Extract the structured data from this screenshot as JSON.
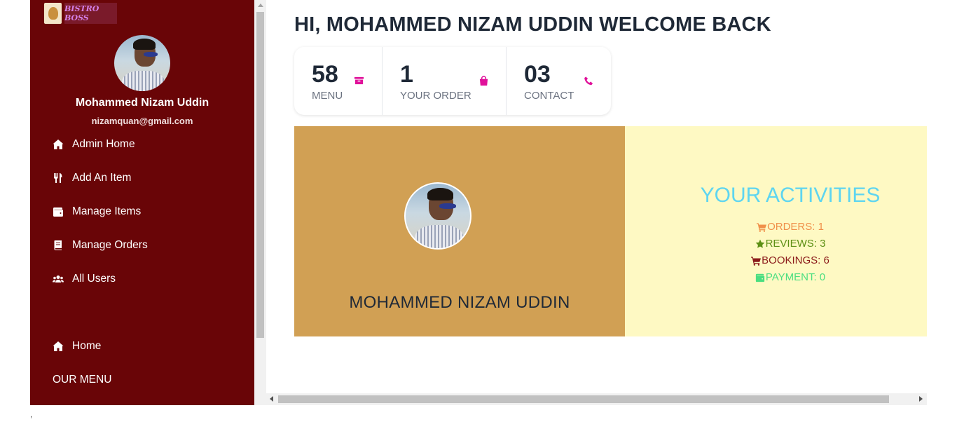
{
  "brand": {
    "logo_text": "BISTRO BOSS"
  },
  "user": {
    "name": "Mohammed Nizam Uddin",
    "email": "nizamquan@gmail.com",
    "name_upper": "MOHAMMED NIZAM UDDIN"
  },
  "nav": {
    "items": [
      {
        "label": "Admin Home",
        "icon": "home-icon"
      },
      {
        "label": "Add An Item",
        "icon": "utensils-icon"
      },
      {
        "label": "Manage Items",
        "icon": "wallet-icon"
      },
      {
        "label": "Manage Orders",
        "icon": "book-icon"
      },
      {
        "label": "All Users",
        "icon": "users-icon"
      }
    ],
    "footer_items": [
      {
        "label": "Home",
        "icon": "home-icon"
      },
      {
        "label": "OUR MENU"
      }
    ]
  },
  "header": {
    "greeting": "HI, MOHAMMED NIZAM UDDIN WELCOME BACK"
  },
  "stats": [
    {
      "value": "58",
      "label": "MENU",
      "icon": "box-icon"
    },
    {
      "value": "1",
      "label": "YOUR ORDER",
      "icon": "bag-icon"
    },
    {
      "value": "03",
      "label": "CONTACT",
      "icon": "phone-icon"
    }
  ],
  "activities": {
    "title": "YOUR ACTIVITIES",
    "items": [
      {
        "label": "ORDERS: 1",
        "icon": "cart-icon",
        "color": "#f0904a"
      },
      {
        "label": "REVIEWS: 3",
        "icon": "star-icon",
        "color": "#5c8f14"
      },
      {
        "label": "BOOKINGS: 6",
        "icon": "cart-icon",
        "color": "#8b1a1a"
      },
      {
        "label": "PAYMENT: 0",
        "icon": "wallet-icon",
        "color": "#4ade80"
      }
    ]
  },
  "colors": {
    "sidebar": "#690507",
    "banner_left": "#d1a054",
    "banner_right": "#fef9c3",
    "accent": "#e0119a",
    "activity_title": "#5ed5f0"
  },
  "footnote": ","
}
